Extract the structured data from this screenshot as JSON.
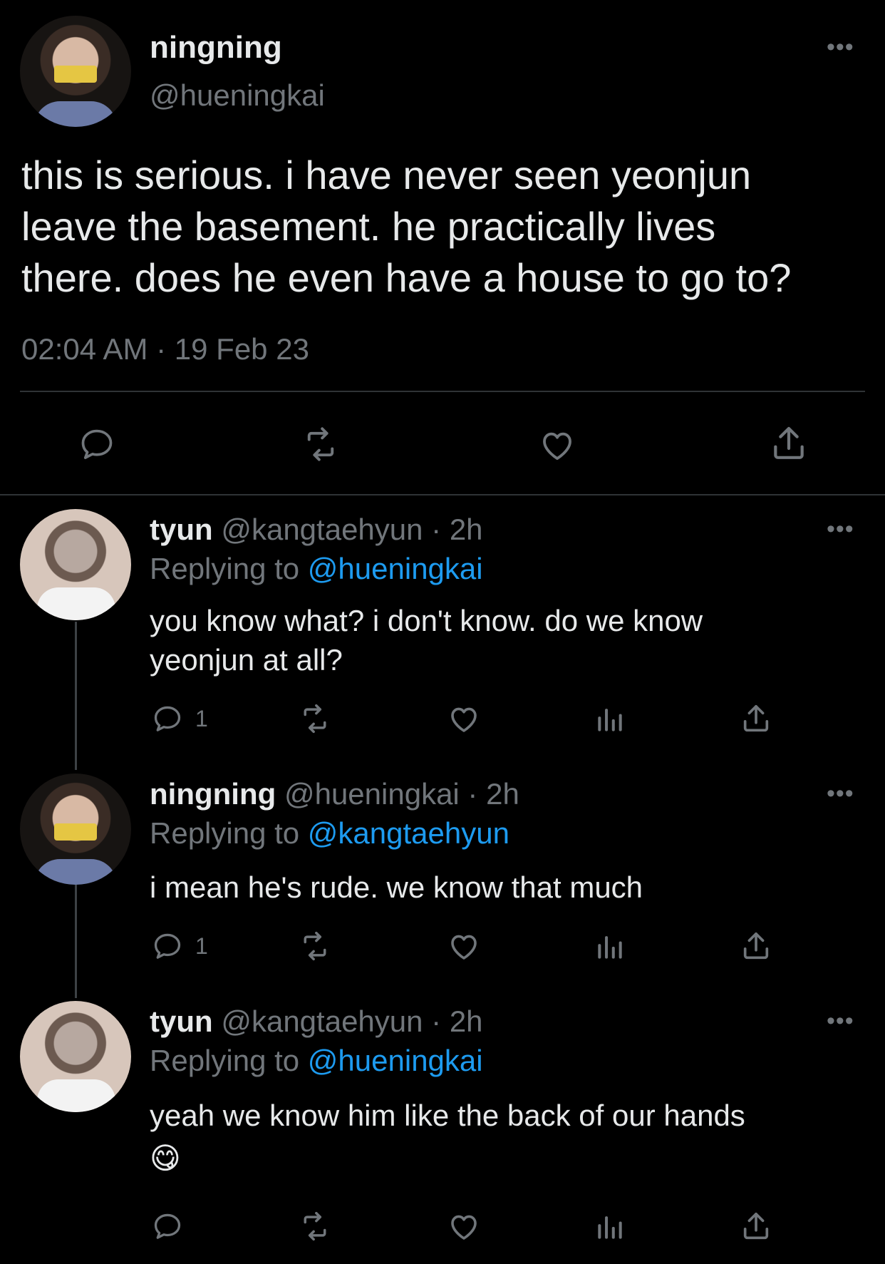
{
  "main_tweet": {
    "display_name": "ningning",
    "handle": "@hueningkai",
    "text_lines": [
      "this is serious. i have never seen yeonjun",
      "leave the basement. he practically lives",
      "there. does he even have a house to go to?"
    ],
    "timestamp": "02:04 AM · 19 Feb 23"
  },
  "replies": [
    {
      "display_name": "tyun",
      "meta": "@kangtaehyun · 2h",
      "replying_prefix": "Replying to ",
      "replying_handle": "@hueningkai",
      "text_lines": [
        "you know what? i don't know. do we know",
        "yeonjun at all?"
      ],
      "reply_count": "1"
    },
    {
      "display_name": "ningning",
      "meta": "@hueningkai · 2h",
      "replying_prefix": "Replying to ",
      "replying_handle": "@kangtaehyun",
      "text_lines": [
        "i mean he's rude. we know that much"
      ],
      "reply_count": "1"
    },
    {
      "display_name": "tyun",
      "meta": "@kangtaehyun · 2h",
      "replying_prefix": "Replying to ",
      "replying_handle": "@hueningkai",
      "text_lines": [
        "yeah we know him like the back of our hands",
        "😋"
      ],
      "reply_count": ""
    }
  ],
  "icons": {
    "reply": "reply-icon",
    "retweet": "retweet-icon",
    "like": "heart-icon",
    "views": "views-icon",
    "share": "share-icon",
    "more": "more-icon"
  },
  "colors": {
    "background": "#000000",
    "text": "#e7e9ea",
    "muted": "#71767b",
    "link": "#1d9bf0",
    "divider": "#2f3336"
  }
}
